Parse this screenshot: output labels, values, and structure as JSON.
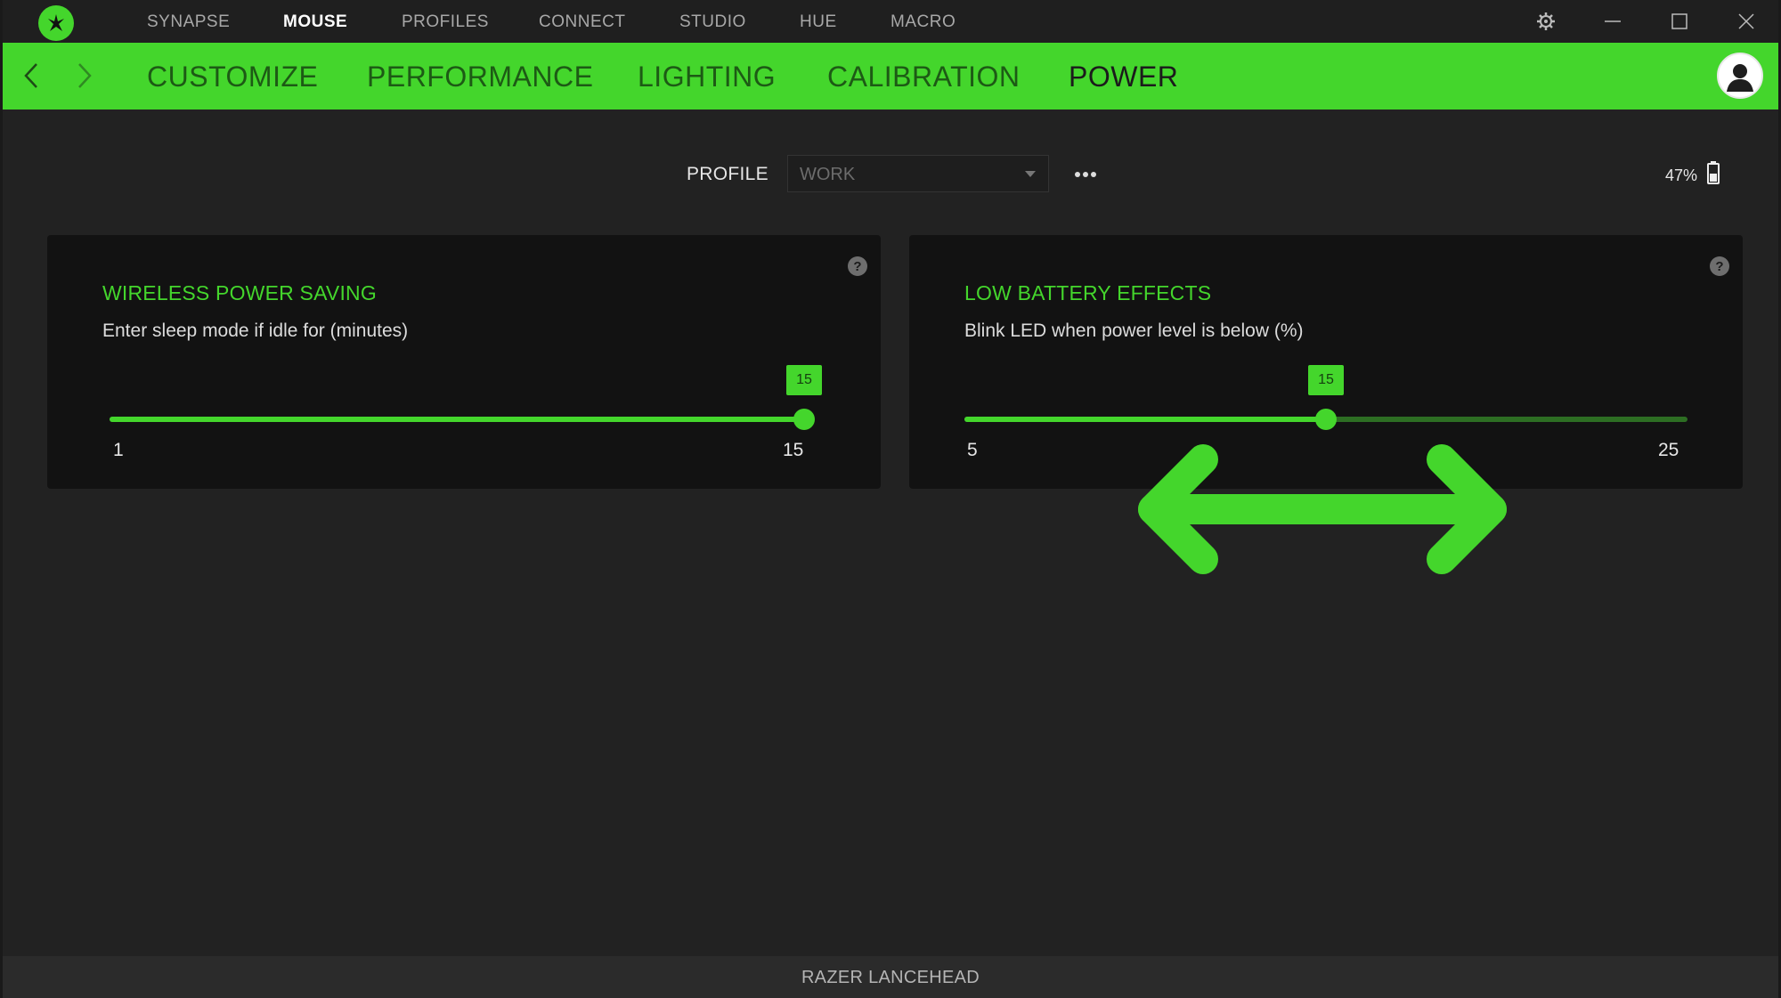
{
  "topbar": {
    "nav": [
      "SYNAPSE",
      "MOUSE",
      "PROFILES",
      "CONNECT",
      "STUDIO",
      "HUE",
      "MACRO"
    ],
    "active_nav": "MOUSE"
  },
  "subnav": {
    "tabs": [
      "CUSTOMIZE",
      "PERFORMANCE",
      "LIGHTING",
      "CALIBRATION",
      "POWER"
    ],
    "active_tab": "POWER"
  },
  "profile": {
    "label": "PROFILE",
    "selected": "WORK",
    "battery": "47%"
  },
  "cards": [
    {
      "title": "WIRELESS POWER SAVING",
      "description": "Enter sleep mode if idle for (minutes)",
      "slider": {
        "min": 1,
        "max": 15,
        "value": 15,
        "min_label": "1",
        "max_label": "15",
        "value_label": "15"
      }
    },
    {
      "title": "LOW BATTERY EFFECTS",
      "description": "Blink LED when power level is below (%)",
      "slider": {
        "min": 5,
        "max": 25,
        "value": 15,
        "min_label": "5",
        "max_label": "25",
        "value_label": "15"
      }
    }
  ],
  "footer": {
    "device": "RAZER LANCEHEAD"
  },
  "colors": {
    "accent": "#44d62c",
    "background": "#222222",
    "card": "#121212",
    "topbar": "#1f1f1f"
  },
  "icons": {
    "logo": "razer-logo-icon",
    "settings": "gear-icon",
    "minimize": "minimize-icon",
    "maximize": "maximize-icon",
    "close": "close-icon",
    "back": "chevron-left-icon",
    "forward": "chevron-right-icon",
    "avatar": "user-icon",
    "more": "ellipsis-icon",
    "battery": "battery-icon",
    "help": "help-icon",
    "overlay": "double-arrow-icon"
  }
}
